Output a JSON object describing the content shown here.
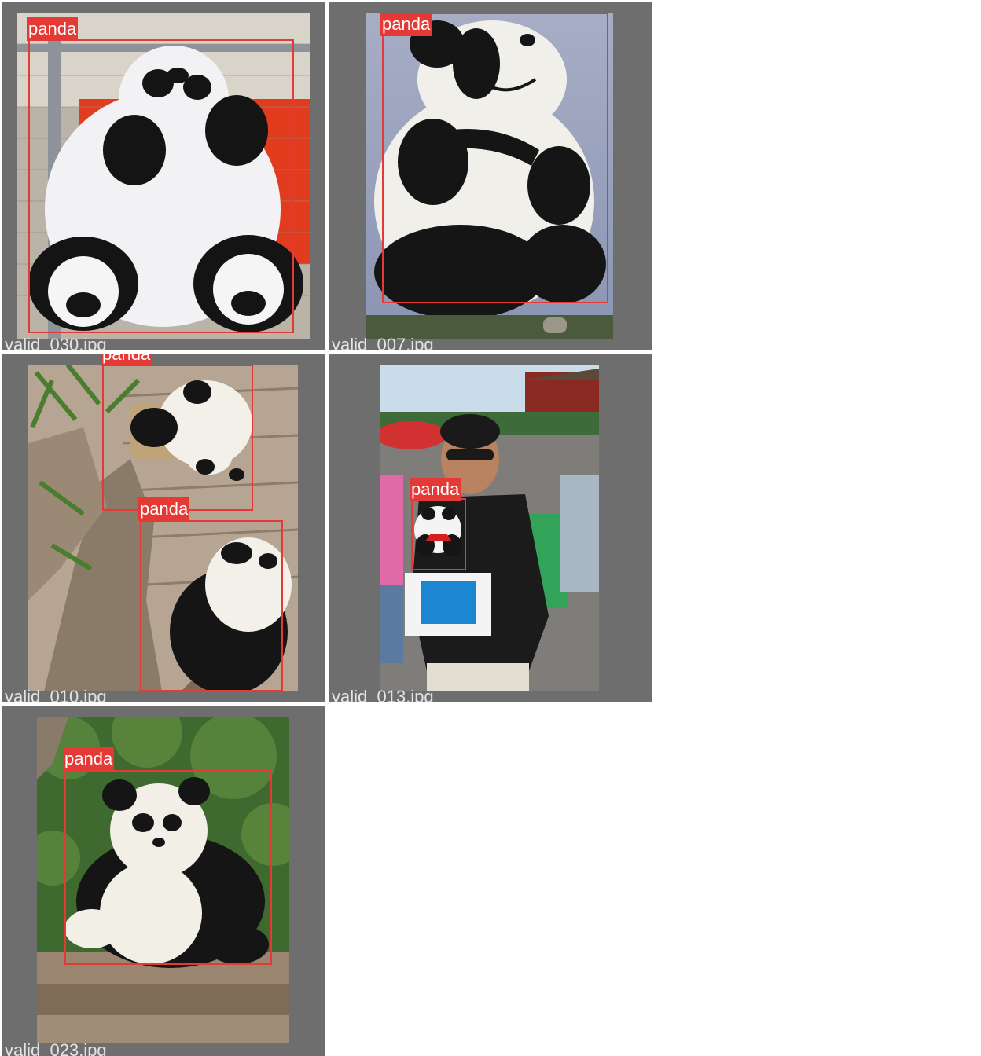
{
  "colors": {
    "background": "#6e6e6e",
    "box": "#e53935",
    "label_text": "#ffffff",
    "filename_text": "#e4e4e4"
  },
  "tiles": [
    {
      "filename": "valid_030.jpg",
      "detections": [
        {
          "label": "panda"
        }
      ]
    },
    {
      "filename": "valid_007.jpg",
      "detections": [
        {
          "label": "panda"
        }
      ]
    },
    {
      "filename": "valid_010.jpg",
      "detections": [
        {
          "label": "panda"
        },
        {
          "label": "panda"
        }
      ]
    },
    {
      "filename": "valid_013.jpg",
      "detections": [
        {
          "label": "panda"
        }
      ]
    },
    {
      "filename": "valid_023.jpg",
      "detections": [
        {
          "label": "panda"
        }
      ]
    }
  ]
}
